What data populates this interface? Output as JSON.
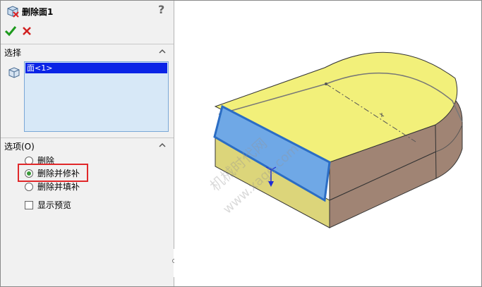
{
  "panel": {
    "title": "删除面1",
    "help": "?",
    "ok_icon": "checkmark-icon",
    "cancel_icon": "x-icon"
  },
  "selection": {
    "header": "选择",
    "items": [
      "面<1>"
    ]
  },
  "options": {
    "header": "选项(O)",
    "radios": [
      {
        "label": "删除",
        "selected": false
      },
      {
        "label": "删除并修补",
        "selected": true
      },
      {
        "label": "删除并填补",
        "selected": false
      }
    ],
    "preview_label": "显示预览",
    "preview_checked": false
  },
  "watermark": {
    "line1": "机械时代网",
    "line2": "www.xage.com"
  },
  "colors": {
    "top_face": "#f2f07a",
    "selected_face": "#6fa8e6",
    "side_face": "#a08474",
    "highlight": "#e0282a",
    "list_selection": "#0a24e6"
  }
}
